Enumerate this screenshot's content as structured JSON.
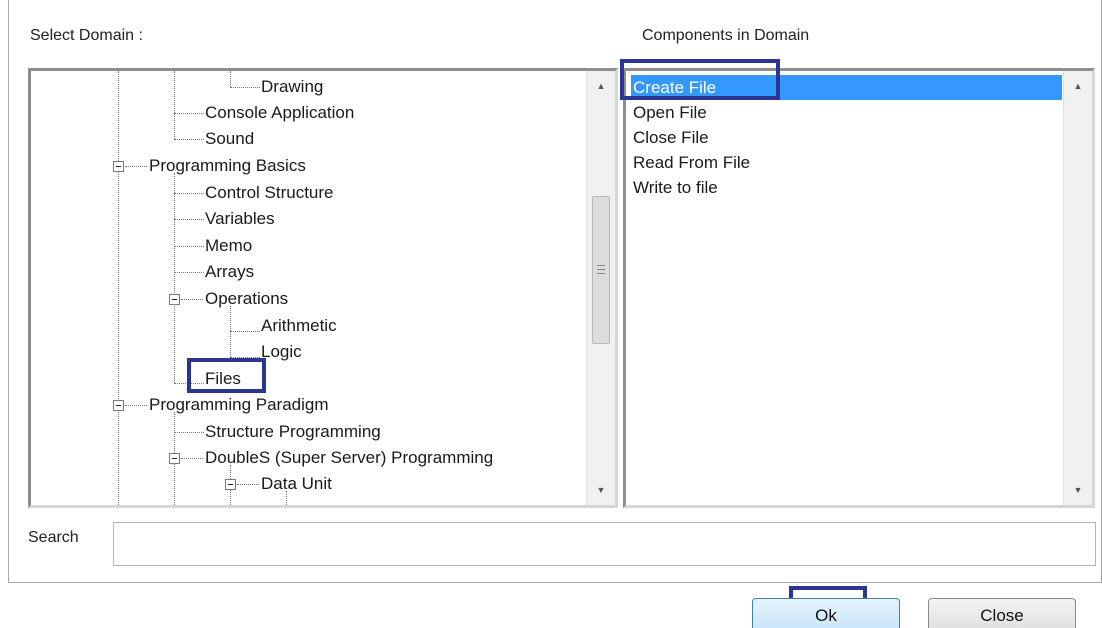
{
  "labels": {
    "select_domain": "Select Domain :",
    "components_in_domain": "Components in Domain",
    "search": "Search"
  },
  "tree": {
    "items": [
      {
        "label": "Drawing",
        "expanded": null
      },
      {
        "label": "Console Application",
        "expanded": null
      },
      {
        "label": "Sound",
        "expanded": null
      },
      {
        "label": "Programming Basics",
        "expanded": true
      },
      {
        "label": "Control Structure",
        "expanded": null
      },
      {
        "label": "Variables",
        "expanded": null
      },
      {
        "label": "Memo",
        "expanded": null
      },
      {
        "label": "Arrays",
        "expanded": null
      },
      {
        "label": "Operations",
        "expanded": true
      },
      {
        "label": "Arithmetic",
        "expanded": null
      },
      {
        "label": "Logic",
        "expanded": null
      },
      {
        "label": "Files",
        "expanded": null,
        "highlighted": true
      },
      {
        "label": "Programming Paradigm",
        "expanded": true
      },
      {
        "label": "Structure Programming",
        "expanded": null
      },
      {
        "label": "DoubleS (Super Server) Programming",
        "expanded": true
      },
      {
        "label": "Data Unit",
        "expanded": true
      }
    ]
  },
  "components": {
    "items": [
      "Create File",
      "Open File",
      "Close File",
      "Read From File",
      "Write to file"
    ],
    "selected": "Create File"
  },
  "search": {
    "value": "",
    "placeholder": ""
  },
  "buttons": {
    "ok": "Ok",
    "close": "Close"
  },
  "colors": {
    "selection": "#3399ff",
    "highlight_box": "#2b3592"
  }
}
